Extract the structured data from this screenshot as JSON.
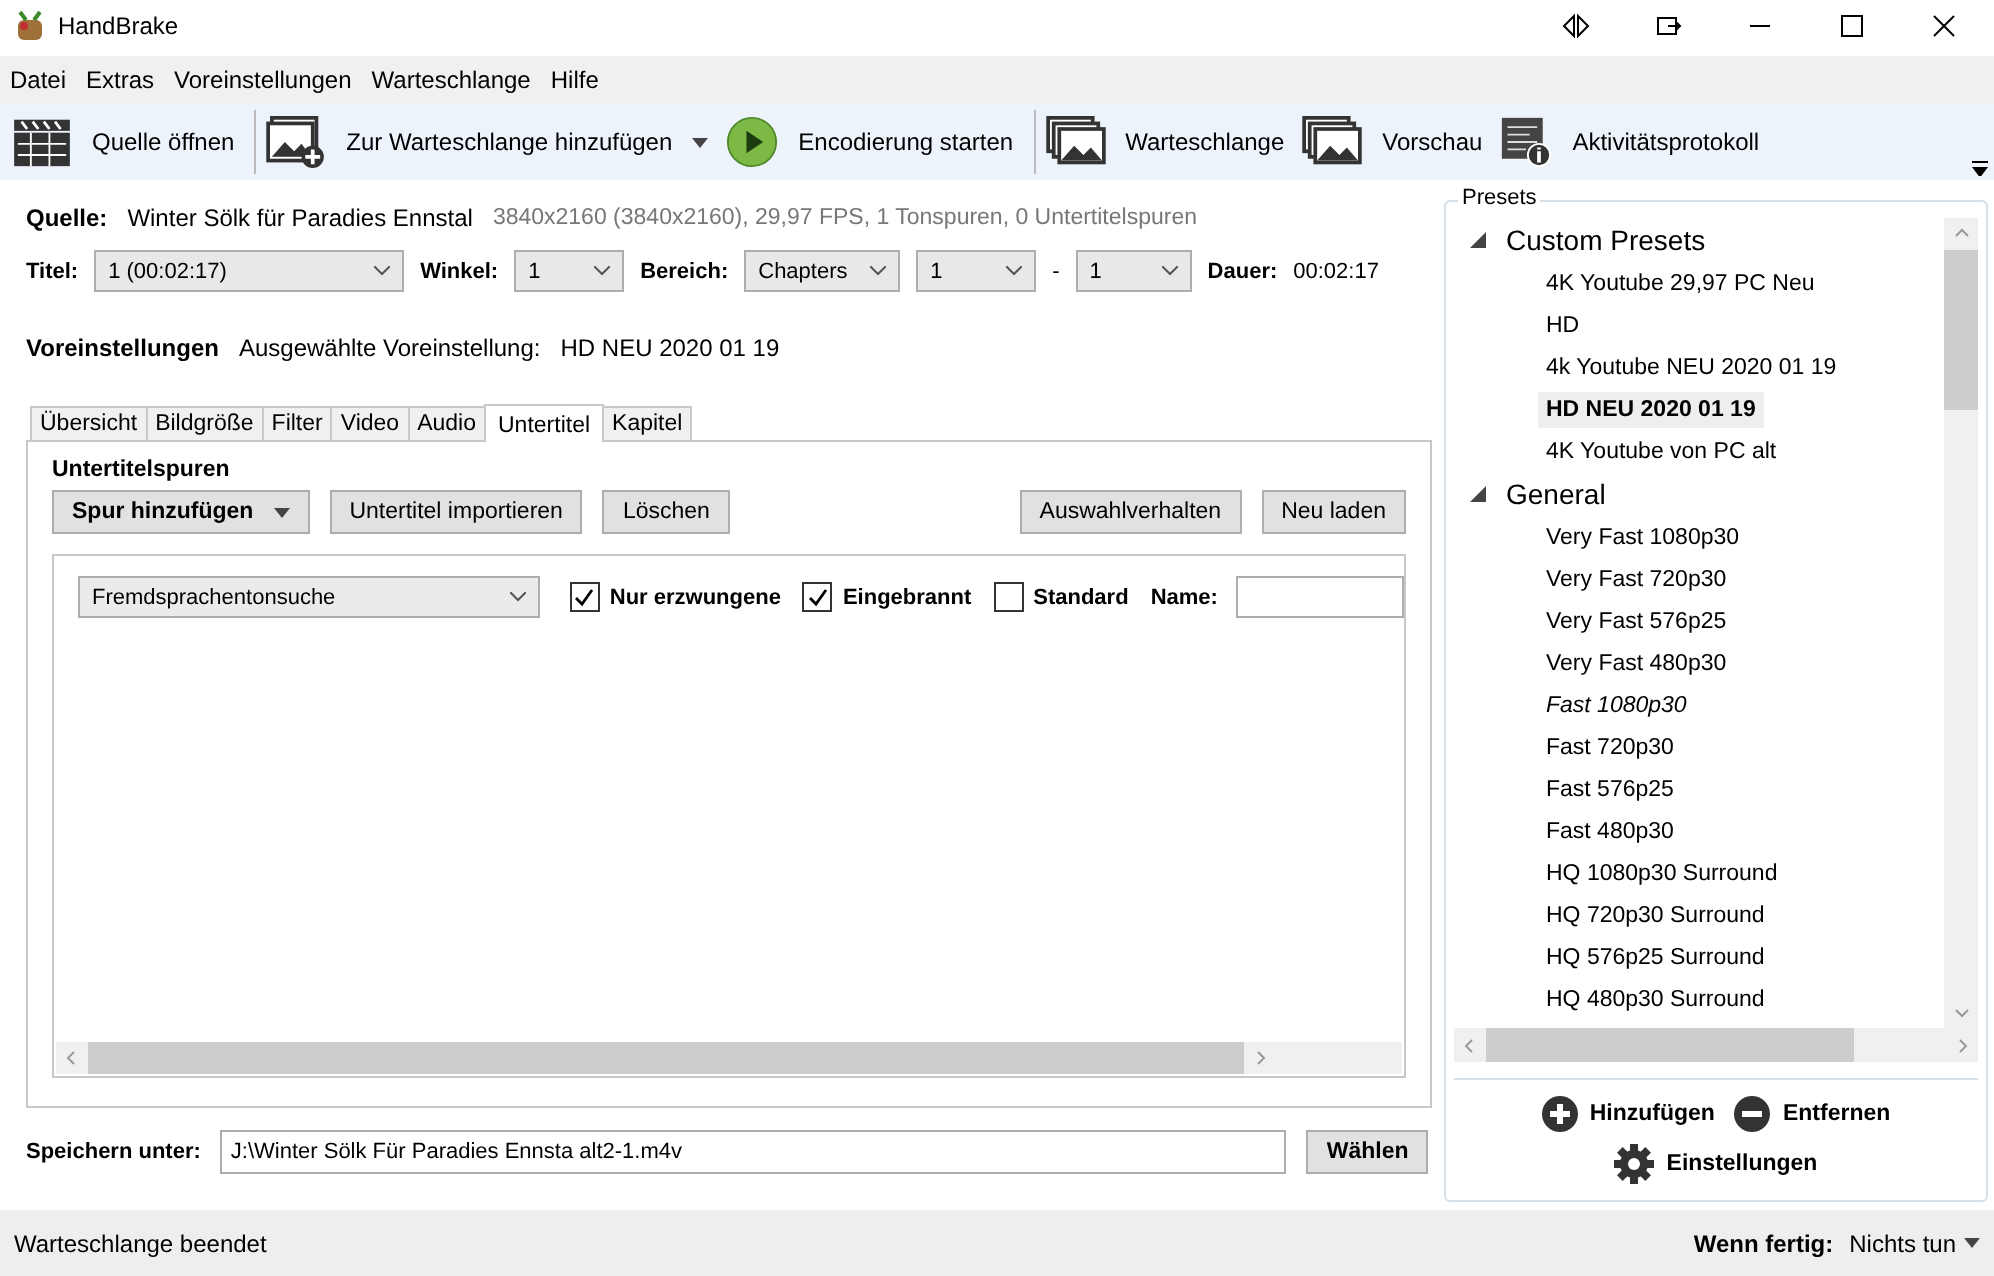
{
  "window": {
    "title": "HandBrake"
  },
  "menu": [
    "Datei",
    "Extras",
    "Voreinstellungen",
    "Warteschlange",
    "Hilfe"
  ],
  "toolbar": [
    {
      "kind": "source",
      "label": "Quelle öffnen",
      "dropdown": false
    },
    {
      "kind": "add",
      "label": "Zur Warteschlange hinzufügen",
      "dropdown": true
    },
    {
      "kind": "start",
      "label": "Encodierung starten",
      "dropdown": false
    },
    {
      "kind": "queue",
      "label": "Warteschlange",
      "dropdown": false
    },
    {
      "kind": "preview",
      "label": "Vorschau",
      "dropdown": false
    },
    {
      "kind": "log",
      "label": "Aktivitätsprotokoll",
      "dropdown": false
    }
  ],
  "source": {
    "label": "Quelle:",
    "name": "Winter Sölk für Paradies Ennstal",
    "info": "3840x2160 (3840x2160), 29,97 FPS, 1 Tonspuren, 0 Untertitelspuren"
  },
  "title_row": {
    "title_label": "Titel:",
    "title_value": "1 (00:02:17)",
    "angle_label": "Winkel:",
    "angle_value": "1",
    "range_label": "Bereich:",
    "range_mode": "Chapters",
    "range_start": "1",
    "range_sep": "-",
    "range_end": "1",
    "duration_label": "Dauer:",
    "duration": "00:02:17"
  },
  "preset_line": {
    "label": "Voreinstellungen",
    "caption": "Ausgewählte Voreinstellung:",
    "value": "HD NEU 2020 01 19"
  },
  "tabs": [
    {
      "label": "Übersicht",
      "selected": false
    },
    {
      "label": "Bildgröße",
      "selected": false
    },
    {
      "label": "Filter",
      "selected": false
    },
    {
      "label": "Video",
      "selected": false
    },
    {
      "label": "Audio",
      "selected": false
    },
    {
      "label": "Untertitel",
      "selected": true
    },
    {
      "label": "Kapitel",
      "selected": false
    }
  ],
  "subtitles": {
    "heading": "Untertitelspuren",
    "buttons": [
      {
        "label": "Spur hinzufügen",
        "kind": "dropdown"
      },
      {
        "label": "Untertitel importieren",
        "kind": "left"
      },
      {
        "label": "Löschen",
        "kind": "left"
      },
      {
        "label": "Auswahlverhalten",
        "kind": "right"
      },
      {
        "label": "Neu laden",
        "kind": "right"
      }
    ],
    "tracks": [
      {
        "track": "Fremdsprachentonsuche",
        "options": [
          {
            "label": "Nur erzwungene",
            "checked": true
          },
          {
            "label": "Eingebrannt",
            "checked": true
          },
          {
            "label": "Standard",
            "checked": false
          }
        ],
        "name_label": "Name:"
      }
    ]
  },
  "save": {
    "label": "Speichern unter:",
    "value": "J:\\Winter Sölk Für Paradies Ennsta alt2-1.m4v",
    "button": "Wählen"
  },
  "presets": {
    "title": "Presets",
    "groups": [
      {
        "label": "Custom Presets",
        "expanded": true,
        "children": [
          {
            "label": "4K Youtube 29,97 PC Neu",
            "selected": false,
            "default": false
          },
          {
            "label": "HD",
            "selected": false,
            "default": false
          },
          {
            "label": "4k Youtube NEU 2020 01 19",
            "selected": false,
            "default": false
          },
          {
            "label": "HD NEU 2020 01 19",
            "selected": true,
            "default": false
          },
          {
            "label": "4K Youtube von PC alt",
            "selected": false,
            "default": false
          }
        ]
      },
      {
        "label": "General",
        "expanded": true,
        "children": [
          {
            "label": "Very Fast 1080p30",
            "selected": false,
            "default": false
          },
          {
            "label": "Very Fast 720p30",
            "selected": false,
            "default": false
          },
          {
            "label": "Very Fast 576p25",
            "selected": false,
            "default": false
          },
          {
            "label": "Very Fast 480p30",
            "selected": false,
            "default": false
          },
          {
            "label": "Fast 1080p30",
            "selected": false,
            "default": true
          },
          {
            "label": "Fast 720p30",
            "selected": false,
            "default": false
          },
          {
            "label": "Fast 576p25",
            "selected": false,
            "default": false
          },
          {
            "label": "Fast 480p30",
            "selected": false,
            "default": false
          },
          {
            "label": "HQ 1080p30 Surround",
            "selected": false,
            "default": false
          },
          {
            "label": "HQ 720p30 Surround",
            "selected": false,
            "default": false
          },
          {
            "label": "HQ 576p25 Surround",
            "selected": false,
            "default": false
          },
          {
            "label": "HQ 480p30 Surround",
            "selected": false,
            "default": false
          }
        ]
      }
    ],
    "actions": [
      {
        "kind": "add",
        "label": "Hinzufügen"
      },
      {
        "kind": "remove",
        "label": "Entfernen"
      },
      {
        "kind": "settings",
        "label": "Einstellungen"
      }
    ]
  },
  "status_bar": {
    "text": "Warteschlange beendet",
    "when_done_label": "Wenn fertig:",
    "when_done_value": "Nichts tun"
  }
}
